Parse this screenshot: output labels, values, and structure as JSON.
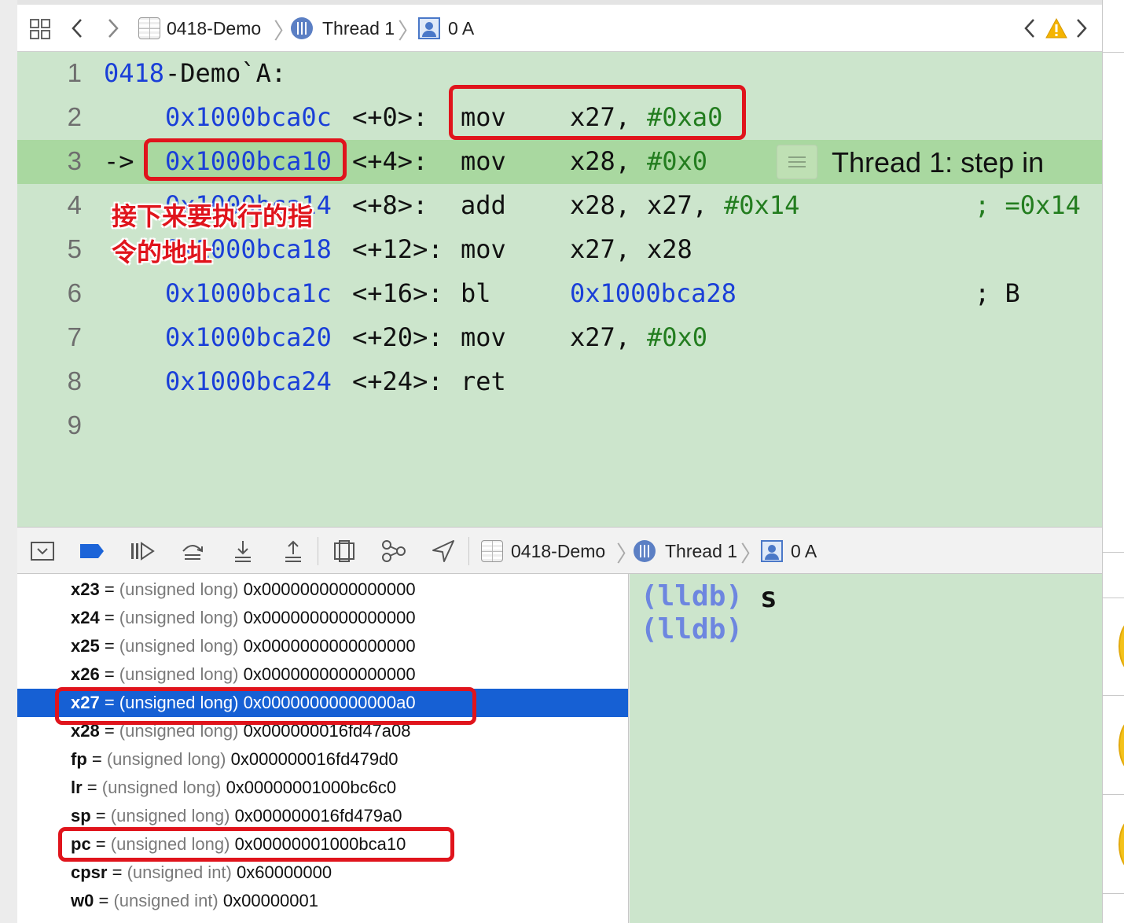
{
  "topbar": {
    "crumbs": [
      "0418-Demo",
      "Thread 1",
      "0 A"
    ]
  },
  "editor": {
    "lines": [
      {
        "num": "1",
        "label": "0418",
        "label_rest": "-Demo`A:"
      },
      {
        "num": "2",
        "addr": "0x1000bca0c",
        "offset": "<+0>:",
        "op": "mov",
        "a1": "x27,",
        "a2": "#0xa0"
      },
      {
        "num": "3",
        "arrow": "->",
        "addr": "0x1000bca10",
        "offset": "<+4>:",
        "op": "mov",
        "a1": "x28,",
        "a2": "#0x0"
      },
      {
        "num": "4",
        "addr": "0x1000bca14",
        "offset": "<+8>:",
        "op": "add",
        "a1": "x28,",
        "a2": "x27,",
        "a3": "#0x14",
        "comment": "; =0x14"
      },
      {
        "num": "5",
        "addr": "0x1000bca18",
        "offset": "<+12>:",
        "op": "mov",
        "a1": "x27,",
        "a2": "x28"
      },
      {
        "num": "6",
        "addr": "0x1000bca1c",
        "offset": "<+16>:",
        "op": "bl",
        "a1": "0x1000bca28",
        "comment": "; B"
      },
      {
        "num": "7",
        "addr": "0x1000bca20",
        "offset": "<+20>:",
        "op": "mov",
        "a1": "x27,",
        "a2": "#0x0"
      },
      {
        "num": "8",
        "addr": "0x1000bca24",
        "offset": "<+24>:",
        "op": "ret"
      },
      {
        "num": "9"
      }
    ],
    "step_message": "Thread 1: step in",
    "annotation_line1": "接下来要执行的指",
    "annotation_line2": "令的地址"
  },
  "debugbar": {
    "crumbs": [
      "0418-Demo",
      "Thread 1",
      "0 A"
    ]
  },
  "variables": [
    {
      "name": "x23",
      "type": "(unsigned long)",
      "value": "0x0000000000000000"
    },
    {
      "name": "x24",
      "type": "(unsigned long)",
      "value": "0x0000000000000000"
    },
    {
      "name": "x25",
      "type": "(unsigned long)",
      "value": "0x0000000000000000"
    },
    {
      "name": "x26",
      "type": "(unsigned long)",
      "value": "0x0000000000000000"
    },
    {
      "name": "x27",
      "type": "(unsigned long)",
      "value": "0x00000000000000a0"
    },
    {
      "name": "x28",
      "type": "(unsigned long)",
      "value": "0x000000016fd47a08"
    },
    {
      "name": "fp",
      "type": "(unsigned long)",
      "value": "0x000000016fd479d0"
    },
    {
      "name": "lr",
      "type": "(unsigned long)",
      "value": "0x00000001000bc6c0"
    },
    {
      "name": "sp",
      "type": "(unsigned long)",
      "value": "0x000000016fd479a0"
    },
    {
      "name": "pc",
      "type": "(unsigned long)",
      "value": "0x00000001000bca10"
    },
    {
      "name": "cpsr",
      "type": "(unsigned int)",
      "value": "0x60000000"
    },
    {
      "name": "w0",
      "type": "(unsigned int)",
      "value": "0x00000001"
    }
  ],
  "console": {
    "prompt": "(lldb)",
    "command": "s"
  },
  "colors": {
    "editor_bg": "#cce5cc",
    "current_line": "#a9d8a0",
    "selection": "#1660d4",
    "highlight_box": "#e0141c",
    "address_blue": "#1a3fd8",
    "literal_green": "#237d1f"
  }
}
